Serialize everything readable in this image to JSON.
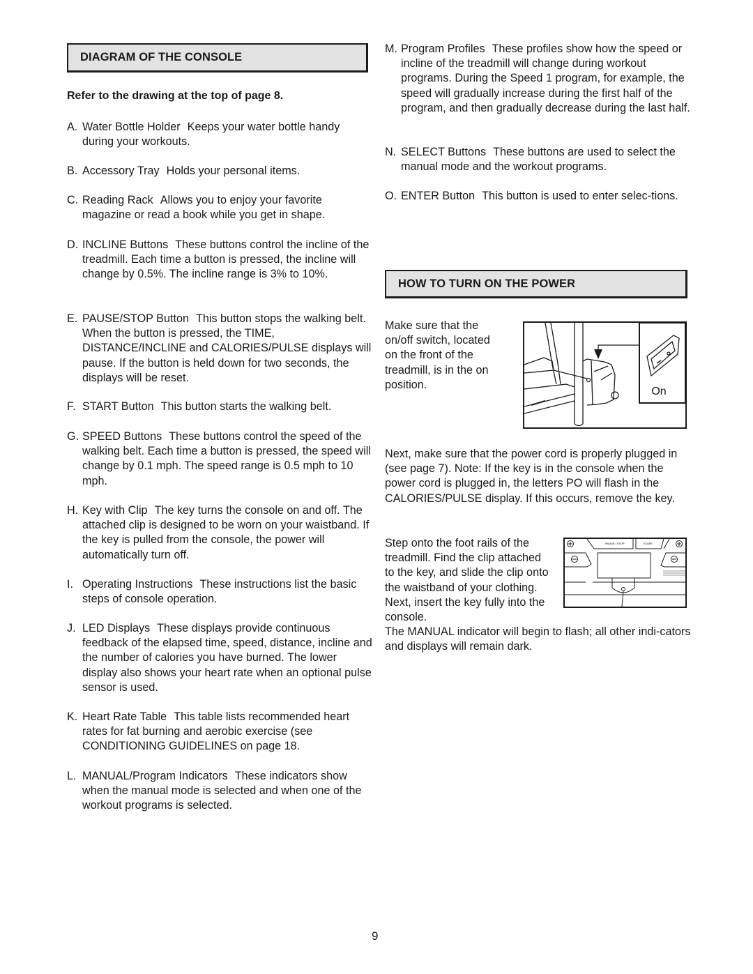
{
  "left_column": {
    "section_title": "DIAGRAM OF THE CONSOLE",
    "subheading": "Refer to the drawing at the top of page 8.",
    "items": [
      {
        "letter": "A.",
        "name": "Water Bottle Holder",
        "desc": "Keeps your water bottle handy during your workouts."
      },
      {
        "letter": "B.",
        "name": "Accessory Tray",
        "desc": "Holds your personal items."
      },
      {
        "letter": "C.",
        "name": "Reading Rack",
        "desc": "Allows you to enjoy your favorite magazine or read a book while you get in shape."
      },
      {
        "letter": "D.",
        "name": "INCLINE Buttons",
        "desc": "These buttons control the incline of the treadmill. Each time a button is pressed, the incline will change by 0.5%. The incline range is 3% to 10%."
      },
      {
        "letter": "E.",
        "name": "PAUSE/STOP Button",
        "desc": "This button stops the walking belt. When the button is pressed, the TIME, DISTANCE/INCLINE and CALORIES/PULSE displays will pause. If the button is held down for two seconds, the displays will be reset."
      },
      {
        "letter": "F.",
        "name": "START Button",
        "desc": "This button starts the walking belt."
      },
      {
        "letter": "G.",
        "name": "SPEED Buttons",
        "desc": "These buttons control the speed of the walking belt. Each time a button is pressed, the speed will change by 0.1 mph. The speed range is 0.5 mph to 10 mph."
      },
      {
        "letter": "H.",
        "name": "Key with Clip",
        "desc": "The key turns the console on and off. The attached clip is designed to be worn on your waistband. If the key is pulled from the console, the power will automatically turn off."
      },
      {
        "letter": "I.",
        "name": "Operating Instructions",
        "desc": "These instructions list the basic steps of console operation."
      },
      {
        "letter": "J.",
        "name": "LED Displays",
        "desc": "These displays provide continuous feedback of the elapsed time, speed, distance, incline and the number of calories you have burned. The lower display also shows your heart rate when an optional pulse sensor is used."
      },
      {
        "letter": "K.",
        "name": "Heart Rate Table",
        "desc": "This table lists recommended heart rates for fat burning and aerobic exercise (see CONDITIONING GUIDELINES on page 18."
      },
      {
        "letter": "L.",
        "name": "MANUAL/Program Indicators",
        "desc": "These indicators show when the manual mode is selected and when one of the workout programs is selected."
      }
    ]
  },
  "right_column": {
    "items": [
      {
        "letter": "M.",
        "name": "Program Profiles",
        "desc": "These profiles show how the speed or incline of the treadmill will change during workout programs. During the Speed 1 program, for example, the speed will gradually increase during the first half of the program, and then gradually decrease during the last half."
      },
      {
        "letter": "N.",
        "name": "SELECT Buttons",
        "desc": "These buttons are used to select the manual mode and the workout programs."
      },
      {
        "letter": "O.",
        "name": "ENTER Button",
        "desc": "This button is used to enter selec-tions."
      }
    ],
    "section_title": "HOW TO TURN ON THE POWER",
    "para_switch": "Make sure that the on/off switch, located on the front of the treadmill, is in the on position.",
    "switch_figure": {
      "label": "On",
      "icon": "power-switch-illustration"
    },
    "para_cord": "Next, make sure that the power cord is properly plugged in (see page 7). Note: If the key is in the console when the power cord is plugged in, the letters  PO  will flash in the CALORIES/PULSE display. If this occurs, remove the key.",
    "para_clip": "Step onto the foot rails of the treadmill. Find the clip attached to the key, and slide the clip onto the waistband of your clothing. Next, insert the key fully into the console.",
    "console_figure": {
      "label_pause": "PAUSE / STOP",
      "label_start": "START",
      "icon": "console-key-illustration"
    },
    "para_manual": "The MANUAL indicator will begin to flash; all other indi-cators and displays will remain dark."
  },
  "page_number": "9"
}
